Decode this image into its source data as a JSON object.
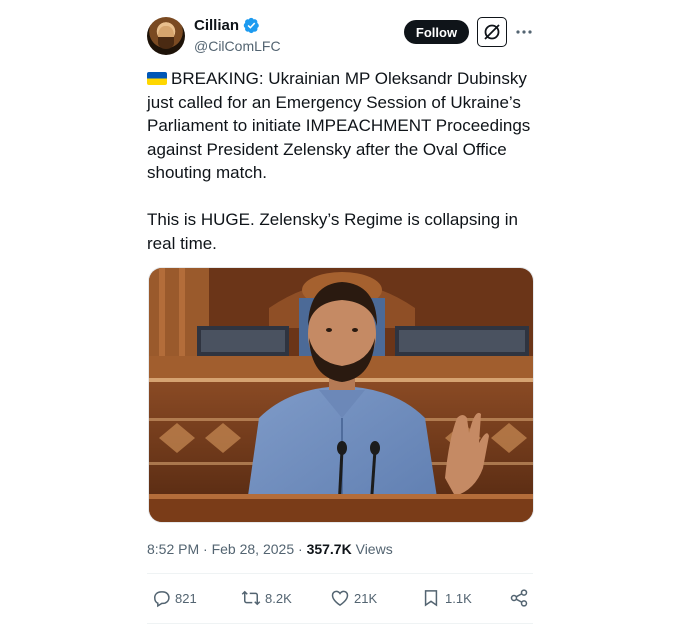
{
  "author": {
    "display_name": "Cillian",
    "handle": "@CilComLFC",
    "verified_icon": "verified-badge-icon",
    "verified_color": "#1d9bf0"
  },
  "header_actions": {
    "follow_label": "Follow",
    "grok_icon": "grok-icon",
    "more_icon": "more-dots-icon"
  },
  "tweet": {
    "flag_icon": "ukraine-flag-icon",
    "paragraph1": "BREAKING: Ukrainian MP Oleksandr Dubinsky just called for an Emergency Session of Ukraine’s Parliament to initiate IMPEACHMENT Proceedings against President Zelensky after the Oval Office shouting match.",
    "paragraph2": "This is HUGE. Zelensky’s Regime is collapsing in real time.",
    "media_icon": "photo"
  },
  "meta": {
    "time": "8:52 PM",
    "separator": "·",
    "date": "Feb 28, 2025",
    "views_count": "357.7K",
    "views_label": "Views"
  },
  "actions": {
    "replies": "821",
    "reposts": "8.2K",
    "likes": "21K",
    "bookmarks": "1.1K",
    "reply_icon": "reply-icon",
    "repost_icon": "repost-icon",
    "like_icon": "heart-icon",
    "bookmark_icon": "bookmark-icon",
    "share_icon": "share-icon"
  },
  "colors": {
    "text_primary": "#0f1419",
    "text_secondary": "#536471",
    "divider": "#eff3f4",
    "flag_blue": "#0057b7",
    "flag_yellow": "#ffd700"
  }
}
